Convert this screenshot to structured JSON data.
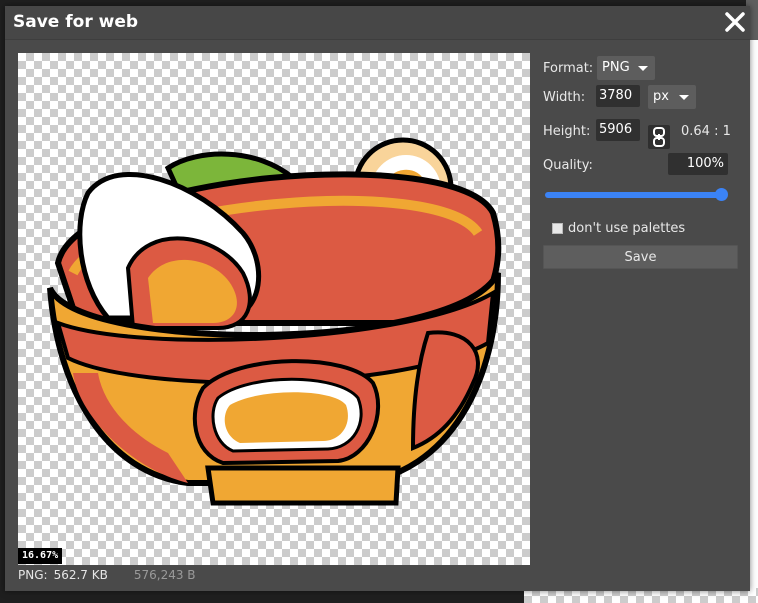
{
  "dialog": {
    "title": "Save for web",
    "close_icon": "close-icon"
  },
  "preview": {
    "zoom": "16.67%",
    "image_icon": "ramen-bowl-image"
  },
  "footer": {
    "format": "PNG:",
    "size": "562.7 KB",
    "bytes": "576,243 B"
  },
  "options": {
    "format_label": "Format:",
    "format_value": "PNG",
    "width_label": "Width:",
    "width_value": "3780",
    "unit_value": "px",
    "height_label": "Height:",
    "height_value": "5906",
    "ratio": "0.64 : 1",
    "quality_label": "Quality:",
    "quality_value": "100%",
    "quality_level": 1.0,
    "palette_label": "don't use palettes",
    "palette_checked": false,
    "save_label": "Save"
  },
  "colors": {
    "accent": "#3b83f6",
    "dialog_bg": "#4a4a4a",
    "field_bg": "#303030"
  }
}
